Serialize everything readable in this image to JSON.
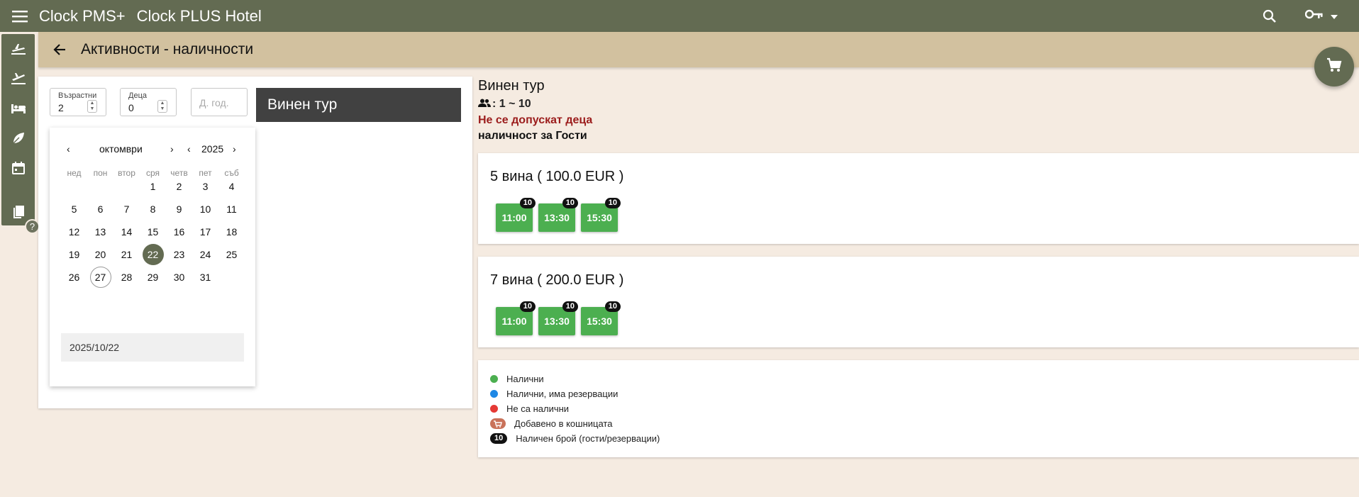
{
  "topbar": {
    "app_name": "Clock PMS+",
    "hotel_name": "Clock PLUS Hotel"
  },
  "subheader": {
    "title": "Активности - наличности"
  },
  "filters": {
    "adults_label": "Възрастни",
    "adults_value": "2",
    "children_label": "Деца",
    "children_value": "0",
    "dob_placeholder": "Д. год."
  },
  "tour_button": "Винен тур",
  "calendar": {
    "month": "октомври",
    "year": "2025",
    "weekdays": [
      "нед",
      "пон",
      "втор",
      "сря",
      "четв",
      "пет",
      "съб"
    ],
    "selected_day": "22",
    "today_day": "27",
    "date_value": "2025/10/22"
  },
  "tour": {
    "name": "Винен тур",
    "capacity": ": 1 ~ 10",
    "no_children": "Не се допускат деца",
    "availability_for": "наличност за Гости"
  },
  "offers": [
    {
      "title": "5 вина ( 100.0 EUR )",
      "slots": [
        {
          "time": "11:00",
          "count": "10"
        },
        {
          "time": "13:30",
          "count": "10"
        },
        {
          "time": "15:30",
          "count": "10"
        }
      ]
    },
    {
      "title": "7 вина ( 200.0 EUR )",
      "slots": [
        {
          "time": "11:00",
          "count": "10"
        },
        {
          "time": "13:30",
          "count": "10"
        },
        {
          "time": "15:30",
          "count": "10"
        }
      ]
    }
  ],
  "legend": {
    "available": "Налични",
    "available_reserved": "Налични, има резервации",
    "unavailable": "Не са налични",
    "in_cart": "Добавено в кошницата",
    "count_chip": "10",
    "count_desc": "Наличен брой (гости/резервации)"
  },
  "colors": {
    "primary": "#636b52",
    "header_tan": "#d2c19f",
    "available": "#4caf50",
    "reserved": "#1e88e5",
    "unavailable": "#e53935",
    "cart": "#c9725a"
  }
}
